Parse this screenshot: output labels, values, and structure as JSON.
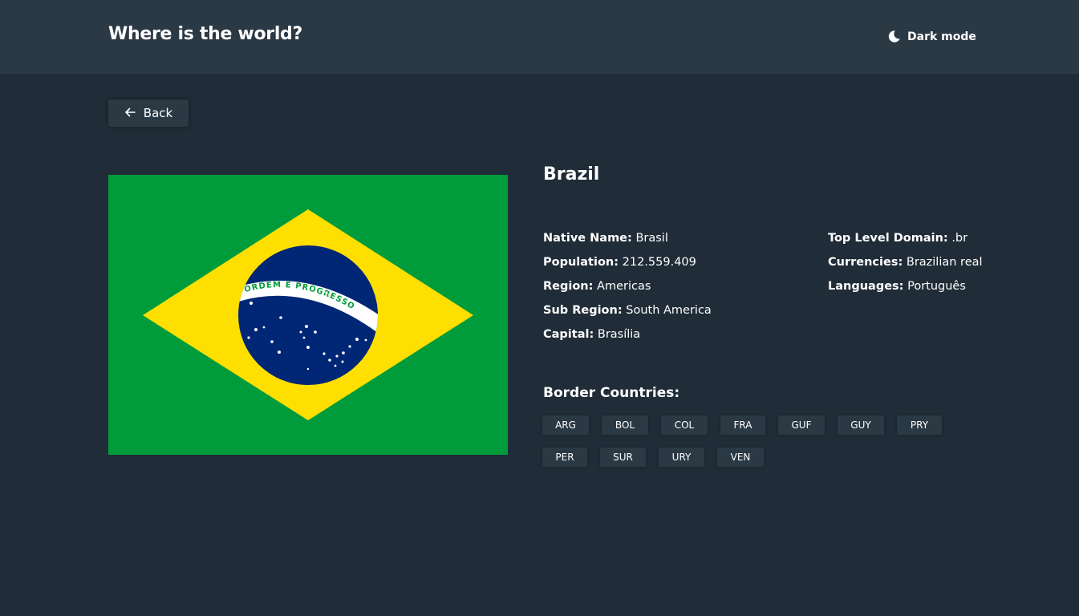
{
  "header": {
    "title": "Where is the world?",
    "dark_mode_label": "Dark mode",
    "dark_mode_icon": "moon-icon"
  },
  "back": {
    "label": "Back",
    "icon": "arrow-left-icon"
  },
  "flag": {
    "motto": "ORDEM E PROGRESSO",
    "colors": {
      "green": "#009c3b",
      "yellow": "#ffdf00",
      "blue": "#002776",
      "white": "#ffffff"
    }
  },
  "country": {
    "name": "Brazil",
    "native_name": {
      "label": "Native Name:",
      "value": "Brasil"
    },
    "population": {
      "label": "Population:",
      "value": "212.559.409"
    },
    "region": {
      "label": "Region:",
      "value": "Americas"
    },
    "sub_region": {
      "label": "Sub Region:",
      "value": "South America"
    },
    "capital": {
      "label": "Capital:",
      "value": "Brasília"
    },
    "tld": {
      "label": "Top Level Domain:",
      "value": ".br"
    },
    "currencies": {
      "label": "Currencies:",
      "value": "Brazilian real"
    },
    "languages": {
      "label": "Languages:",
      "value": "Português"
    }
  },
  "border": {
    "title": "Border Countries:",
    "countries": [
      "ARG",
      "BOL",
      "COL",
      "FRA",
      "GUF",
      "GUY",
      "PRY",
      "PER",
      "SUR",
      "URY",
      "VEN"
    ]
  },
  "theme": {
    "background": "#202c37",
    "elements": "#2b3945",
    "text": "#ffffff"
  }
}
